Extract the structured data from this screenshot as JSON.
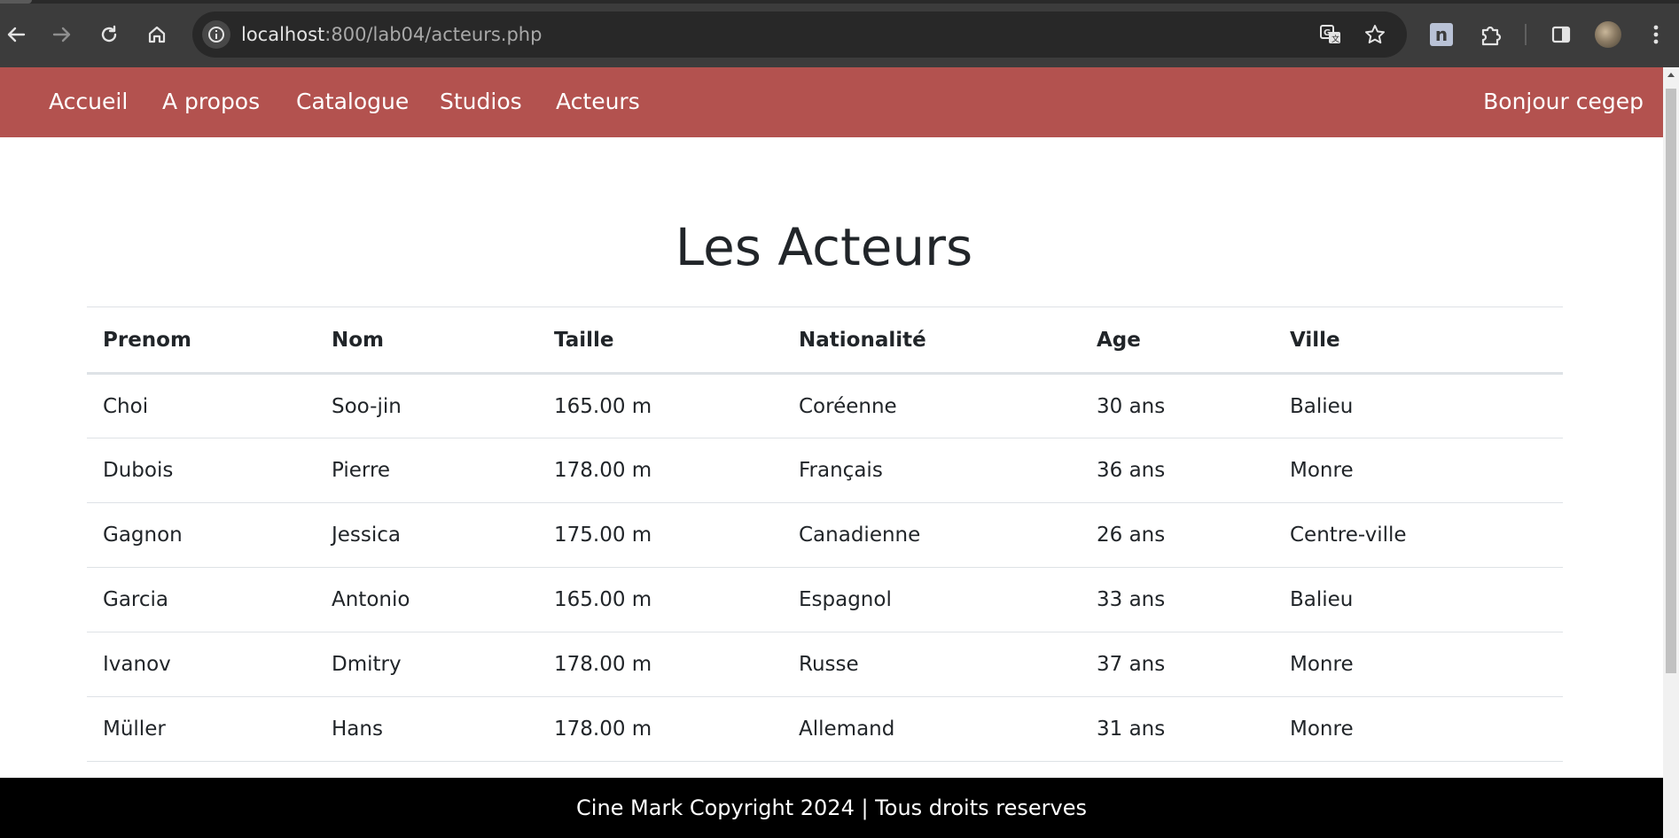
{
  "browser": {
    "url_host": "localhost",
    "url_path": ":800/lab04/acteurs.php",
    "icons": [
      "back-arrow-icon",
      "forward-arrow-icon",
      "reload-icon",
      "home-icon",
      "site-info-icon",
      "translate-icon",
      "bookmark-star-icon",
      "extension-n-icon",
      "extensions-puzzle-icon",
      "side-panel-icon",
      "profile-avatar",
      "more-menu-icon"
    ],
    "extension_letter": "n"
  },
  "navbar": {
    "color": "#b3524f",
    "links": [
      "Accueil",
      "A propos",
      "Catalogue",
      "Studios",
      "Acteurs"
    ],
    "greeting": "Bonjour cegep"
  },
  "page": {
    "title": "Les Acteurs"
  },
  "table": {
    "headers": [
      "Prenom",
      "Nom",
      "Taille",
      "Nationalité",
      "Age",
      "Ville"
    ],
    "rows": [
      [
        "Choi",
        "Soo-jin",
        "165.00 m",
        "Coréenne",
        "30 ans",
        "Balieu"
      ],
      [
        "Dubois",
        "Pierre",
        "178.00 m",
        "Français",
        "36 ans",
        "Monre"
      ],
      [
        "Gagnon",
        "Jessica",
        "175.00 m",
        "Canadienne",
        "26 ans",
        "Centre-ville"
      ],
      [
        "Garcia",
        "Antonio",
        "165.00 m",
        "Espagnol",
        "33 ans",
        "Balieu"
      ],
      [
        "Ivanov",
        "Dmitry",
        "178.00 m",
        "Russe",
        "37 ans",
        "Monre"
      ],
      [
        "Müller",
        "Hans",
        "178.00 m",
        "Allemand",
        "31 ans",
        "Monre"
      ]
    ]
  },
  "footer": {
    "text": "Cine Mark Copyright 2024 | Tous droits reserves"
  }
}
